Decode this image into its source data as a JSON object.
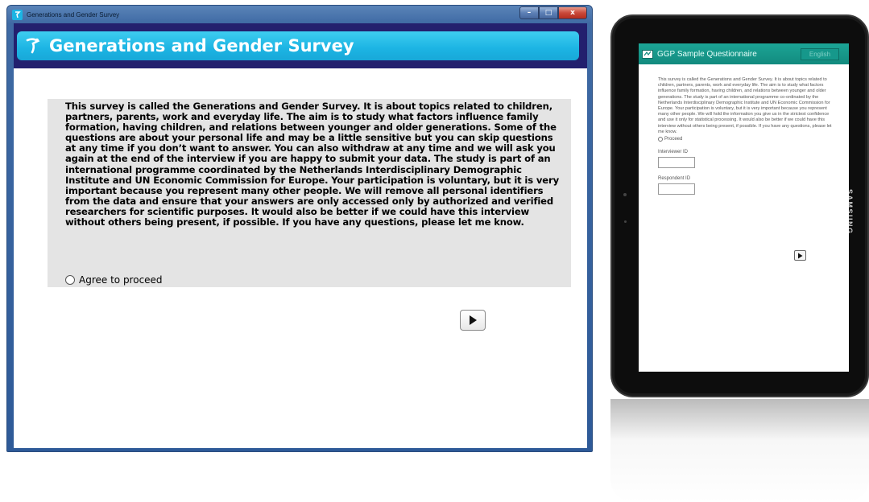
{
  "desktop_window": {
    "title": "Generations and Gender Survey",
    "controls": {
      "minimize": "–",
      "maximize": "□",
      "close": "x"
    },
    "app_title": "Generations and Gender Survey",
    "intro_text": "This survey is called the Generations and Gender Survey. It is about topics related to children, partners, parents, work and everyday life. The aim is to study what factors influence family formation, having children, and relations between younger and older generations. Some of the questions are about your personal life and may be a little sensitive but you can skip questions at any time if you don’t want to answer. You can also withdraw at any time and we will ask you again at the end of the interview if you are happy to submit your data. The study is part of an international programme coordinated by the Netherlands Interdisciplinary Demographic Institute and UN Economic Commission for Europe. Your participation is voluntary, but it is very important because you represent many other people. We will remove all personal identifiers from the data and ensure that your answers are only accessed only by authorized and verified researchers for scientific purposes. It would also be better if we could have this interview without others being present, if possible. If you have any questions, please let me know.",
    "agree_label": "Agree to proceed",
    "next_icon": "play-arrow-icon"
  },
  "tablet": {
    "brand": "SAMSUNG",
    "app_title": "GGP Sample Questionnaire",
    "language_button": "English",
    "intro_text": "This survey is called the Generations and Gender Survey. It is about topics related to children, partners, parents, work and everyday life. The aim is to study what factors influence family formation, having children, and relations between younger and older generations. The study is part of an international programme co-ordinated by the Netherlands Interdisciplinary Demographic Institute and UN Economic Commission for Europe. Your participation is voluntary, but it is very important because you represent many other people. We will hold the information you give us in the strictest confidence and use it only for statistical processing. It would also be better if we could have this interview without others being present, if possible. If you have any questions, please let me know.",
    "proceed_label": "Proceed",
    "interviewer_id_label": "Interviewer ID",
    "interviewer_id_value": "",
    "respondent_id_label": "Respondent ID",
    "respondent_id_value": ""
  },
  "colors": {
    "window_frame": "#3f6aa4",
    "app_background": "#23206e",
    "app_header": "#1cb4e3",
    "intro_box": "#e4e4e4",
    "tablet_header": "#128a7e"
  }
}
